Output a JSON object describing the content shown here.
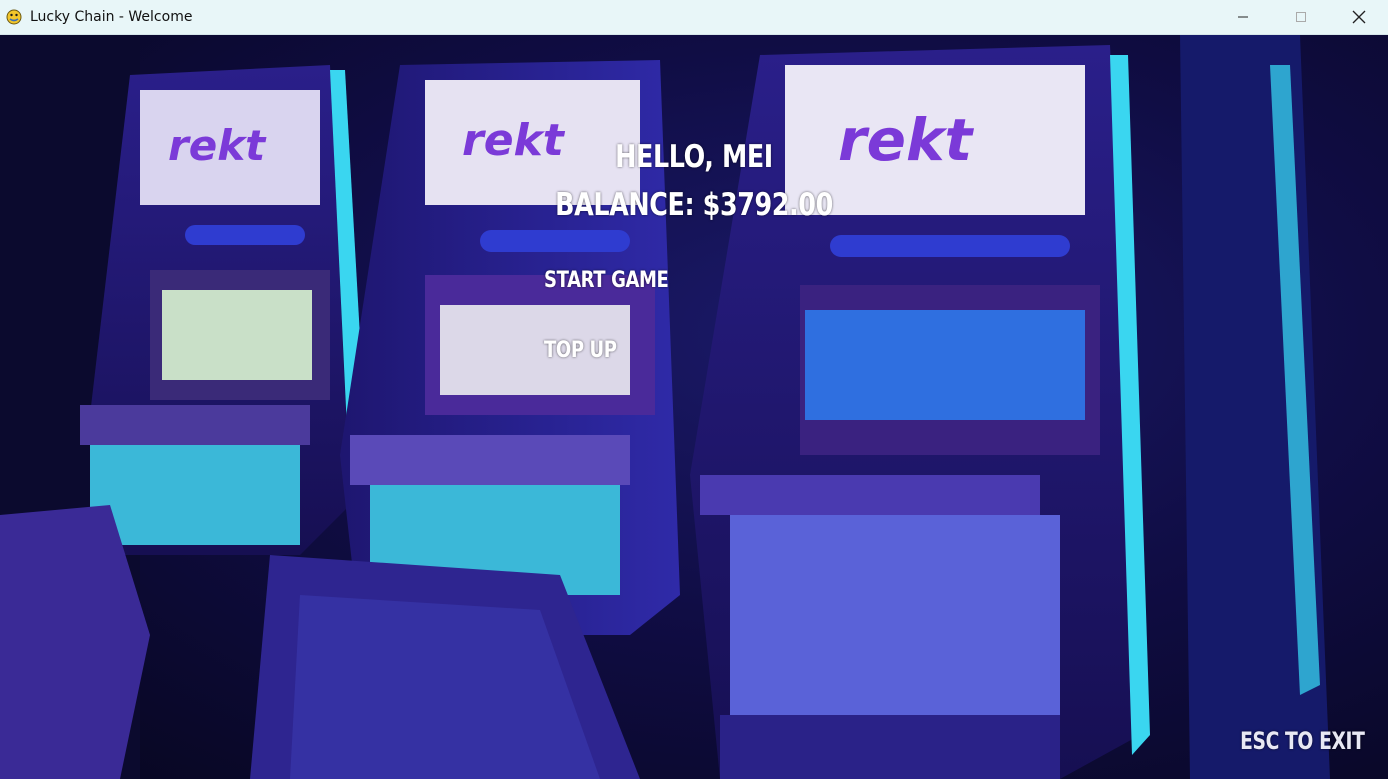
{
  "window": {
    "title": "Lucky Chain - Welcome",
    "controls": [
      "minimize",
      "maximize",
      "close"
    ]
  },
  "game": {
    "greeting": "HELLO, MEI",
    "balance": "BALANCE: $3792.00",
    "menu": {
      "start_game": "START GAME",
      "top_up": "TOP UP"
    },
    "exit_hint": "ESC TO EXIT",
    "slot_logo": "rekt"
  },
  "colors": {
    "titlebar": "#e8f6f8",
    "scene_dark": "#07061e",
    "neon_cyan": "#3ad6f0",
    "neon_purple": "#6b2fd6",
    "text": "#ffffff"
  }
}
